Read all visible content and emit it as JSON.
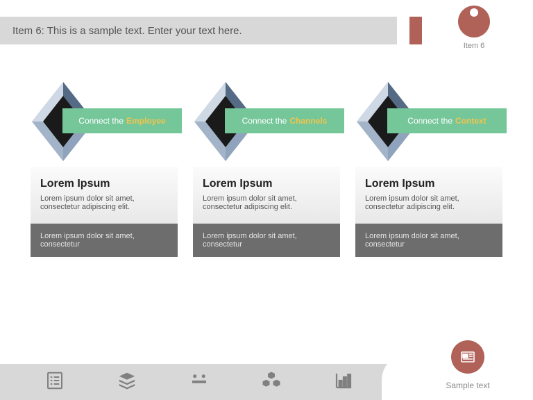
{
  "header": {
    "title": "Item 6: This is a sample text. Enter your text here.",
    "badge_label": "Item 6"
  },
  "columns": [
    {
      "label_prefix": "Connect the",
      "label_highlight": "Employee",
      "card_title": "Lorem Ipsum",
      "card_body": "Lorem ipsum dolor sit amet, consectetur adipiscing elit.",
      "card_footer": "Lorem ipsum dolor sit amet, consectetur"
    },
    {
      "label_prefix": "Connect the",
      "label_highlight": "Channels",
      "card_title": "Lorem Ipsum",
      "card_body": "Lorem ipsum dolor sit amet, consectetur adipiscing elit.",
      "card_footer": "Lorem ipsum dolor sit amet, consectetur"
    },
    {
      "label_prefix": "Connect the",
      "label_highlight": "Context",
      "card_title": "Lorem Ipsum",
      "card_body": "Lorem ipsum dolor sit amet, consectetur adipiscing elit.",
      "card_footer": "Lorem ipsum dolor sit amet, consectetur"
    }
  ],
  "footer": {
    "tab_label": "Sample text"
  },
  "colors": {
    "accent": "#b06258",
    "green": "#75c79a",
    "highlight": "#f2c44b"
  }
}
